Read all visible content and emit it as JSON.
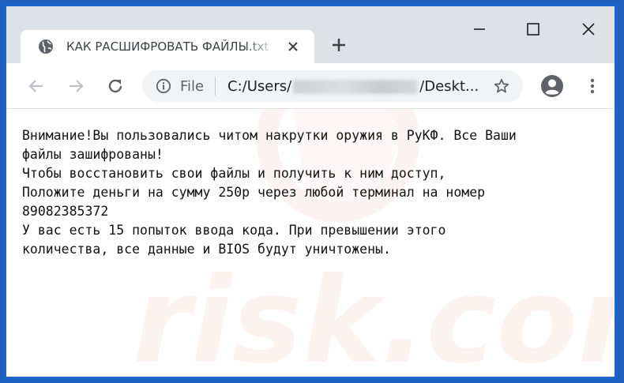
{
  "tab": {
    "title": "КАК РАСШИФРОВАТЬ ФАЙЛЫ.txt"
  },
  "omnibox": {
    "scheme_label": "File",
    "url_prefix": "C:/Users/",
    "url_suffix": "/Deskt..."
  },
  "document": {
    "lines": [
      "Внимание!Вы пользовались читом накрутки оружия в РуКФ. Все Ваши",
      "файлы зашифрованы!",
      "Чтобы восстановить свои файлы и получить к ним доступ,",
      "Положите деньги на сумму 250р через любой терминал на номер",
      "89082385372",
      "У вас есть 15 попыток ввода кода. При превышении этого",
      "количества, все данные и BIOS будут уничтожены."
    ]
  },
  "watermark": {
    "text": "risk.com"
  },
  "colors": {
    "window_border": "#1e64c8",
    "tabstrip": "#dee1e6",
    "omnibox": "#f1f3f4",
    "icon": "#5f6368"
  }
}
